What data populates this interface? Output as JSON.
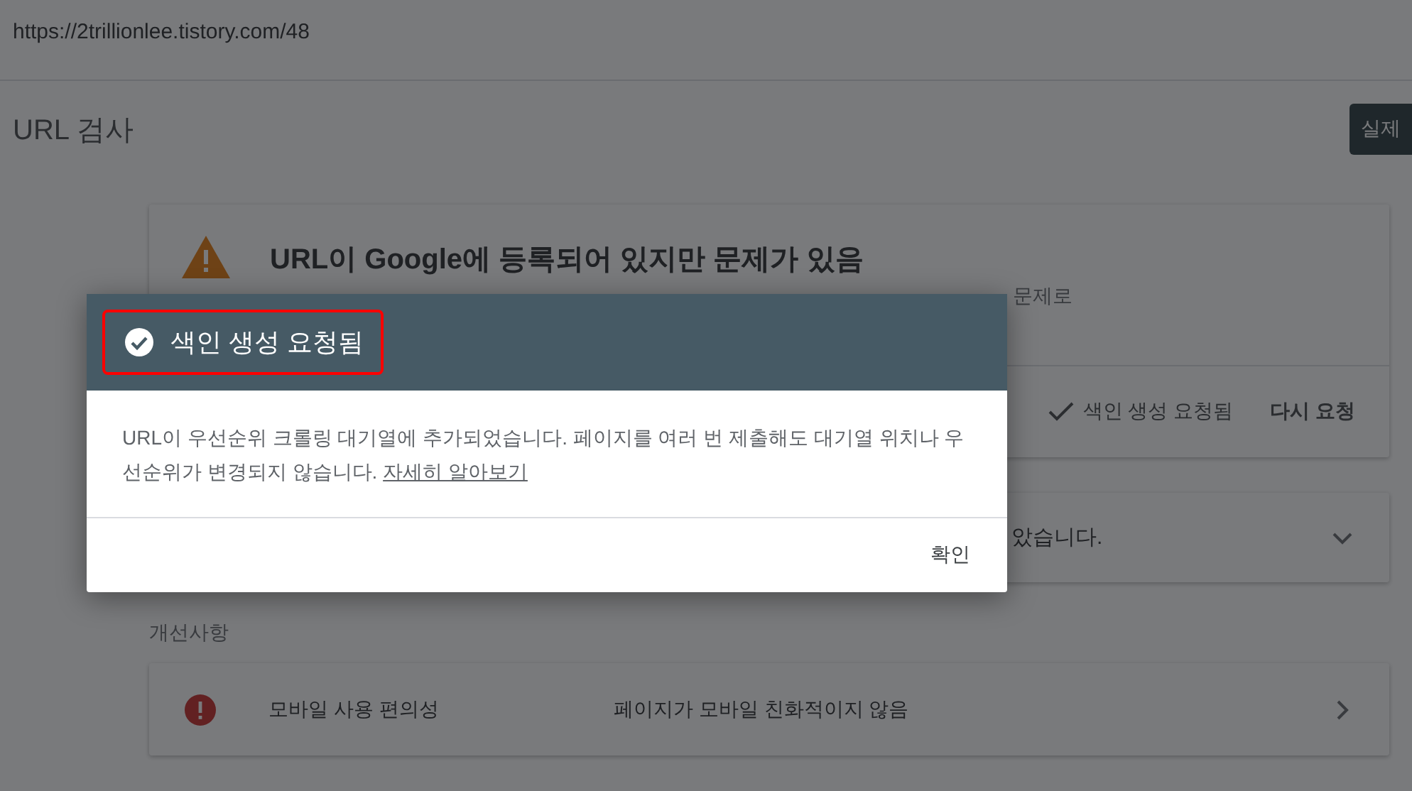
{
  "page_url": "https://2trillionlee.tistory.com/48",
  "header": {
    "title": "URL 검사",
    "action_button": "실제"
  },
  "status_card": {
    "kind": "warning",
    "title": "URL이 Google에 등록되어 있지만 문제가 있음",
    "description": "문제로",
    "status": "색인 생성 요청됨",
    "action": "다시 요청"
  },
  "coverage_card": {
    "text": "았습니다."
  },
  "enhancements": {
    "heading": "개선사항",
    "items": [
      {
        "kind": "error",
        "name": "모바일 사용 편의성",
        "status": "페이지가 모바일 친화적이지 않음"
      }
    ]
  },
  "dialog": {
    "title": "색인 생성 요청됨",
    "highlighted": true,
    "body": "URL이 우선순위 크롤링 대기열에 추가되었습니다. 페이지를 여러 번 제출해도 대기열 위치나 우선순위가 변경되지 않습니다.",
    "link": "자세히 알아보기",
    "button": "확인"
  }
}
